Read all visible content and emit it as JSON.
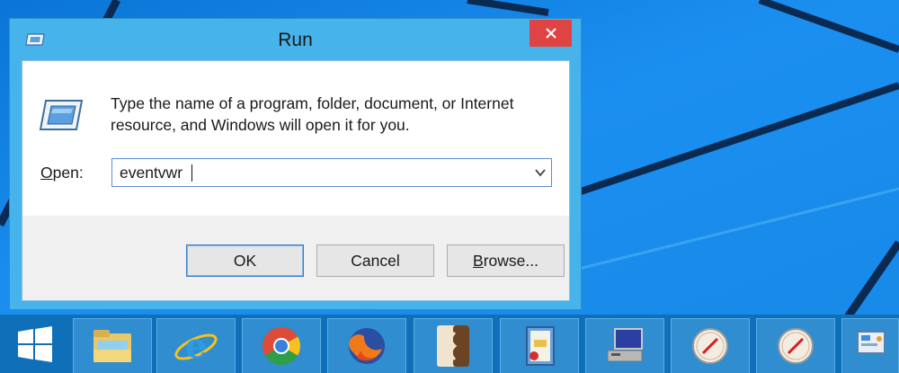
{
  "dialog": {
    "title": "Run",
    "description": "Type the name of a program, folder, document, or Internet resource, and Windows will open it for you.",
    "open_label_accel": "O",
    "open_label_rest": "pen:",
    "input_value": "eventvwr",
    "buttons": {
      "ok": "OK",
      "cancel": "Cancel",
      "browse_accel": "B",
      "browse_rest": "rowse..."
    }
  },
  "taskbar": {
    "items": [
      {
        "icon": "start-windows-icon"
      },
      {
        "icon": "file-explorer-icon"
      },
      {
        "icon": "internet-explorer-icon"
      },
      {
        "icon": "chrome-icon"
      },
      {
        "icon": "firefox-icon"
      },
      {
        "icon": "app-bracket-icon"
      },
      {
        "icon": "notebook-app-icon"
      },
      {
        "icon": "computer-network-icon"
      },
      {
        "icon": "compass-app-icon"
      },
      {
        "icon": "compass-app-icon"
      },
      {
        "icon": "control-panel-icon"
      }
    ]
  },
  "colors": {
    "desktop": "#1788e6",
    "dialog_frame": "#46b3ea",
    "close_button": "#e04343",
    "taskbar": "#0f6fb8"
  }
}
